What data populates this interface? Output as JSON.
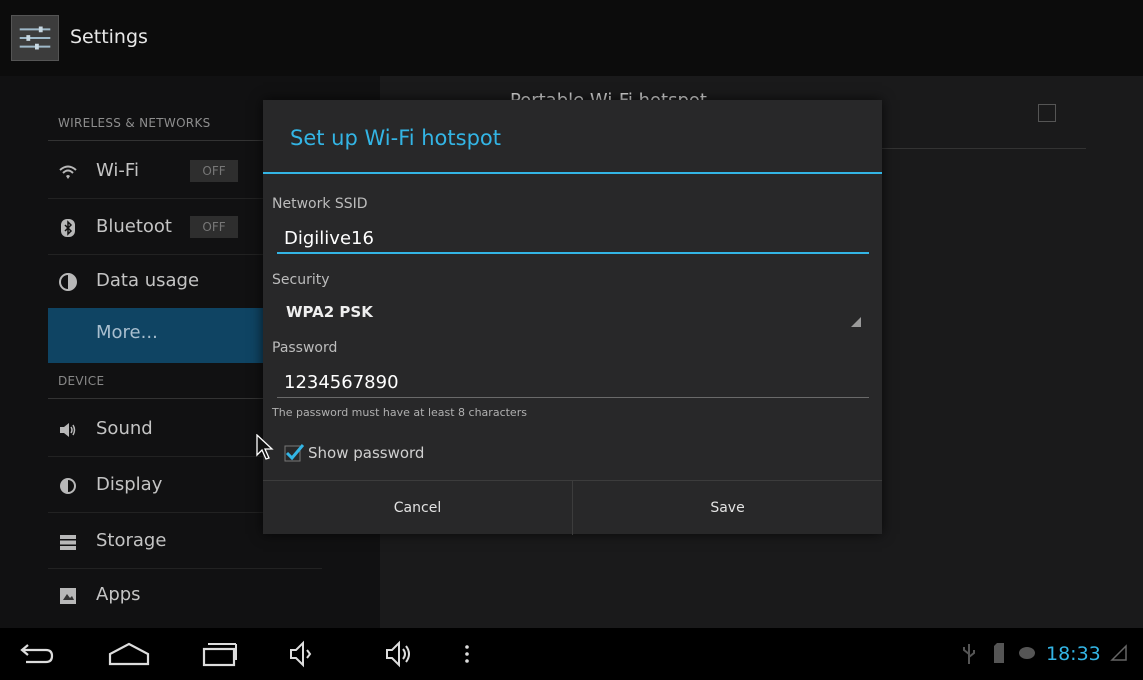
{
  "app": {
    "title": "Settings"
  },
  "sidebar": {
    "sections": [
      {
        "header": "WIRELESS & NETWORKS"
      },
      {
        "header": "DEVICE"
      }
    ],
    "items": [
      {
        "label": "Wi-Fi",
        "icon": "wifi-icon",
        "toggle": "OFF"
      },
      {
        "label": "Bluetoot",
        "icon": "bluetooth-icon",
        "toggle": "OFF"
      },
      {
        "label": "Data usage",
        "icon": "data-usage-icon"
      },
      {
        "label": "More...",
        "selected": true
      },
      {
        "label": "Sound",
        "icon": "speaker-icon"
      },
      {
        "label": "Display",
        "icon": "brightness-icon"
      },
      {
        "label": "Storage",
        "icon": "storage-icon"
      },
      {
        "label": "Apps",
        "icon": "apps-icon"
      }
    ]
  },
  "background_page": {
    "item_title": "Portable Wi-Fi hotspot"
  },
  "dialog": {
    "title": "Set up Wi-Fi hotspot",
    "ssid_label": "Network SSID",
    "ssid_value": "Digilive16",
    "security_label": "Security",
    "security_value": "WPA2 PSK",
    "password_label": "Password",
    "password_value": "1234567890",
    "password_hint": "The password must have at least 8 characters",
    "show_password_label": "Show password",
    "show_password_checked": true,
    "cancel_label": "Cancel",
    "save_label": "Save"
  },
  "statusbar": {
    "time": "18:33"
  },
  "colors": {
    "accent": "#33b5e5",
    "selected_item_bg": "#0f4463"
  }
}
